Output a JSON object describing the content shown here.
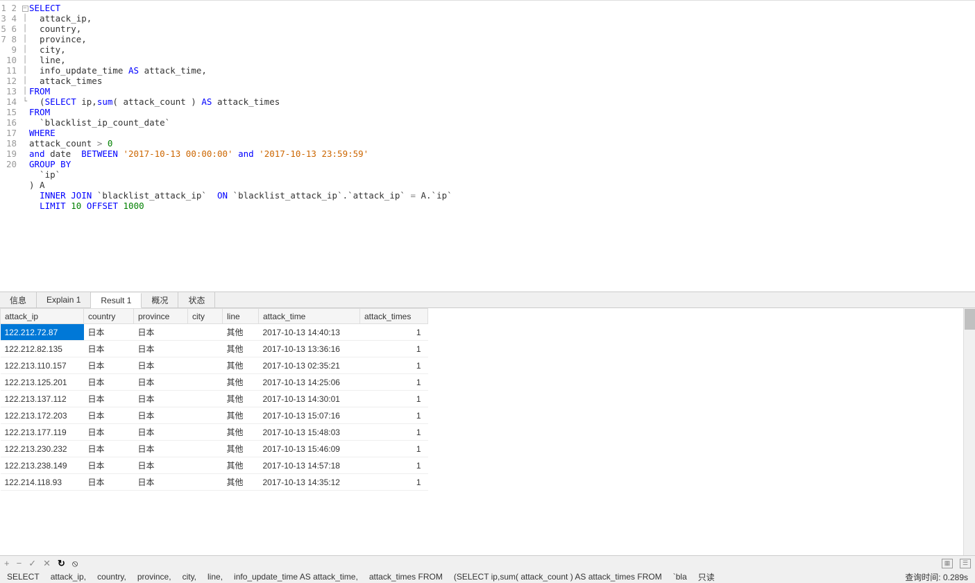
{
  "editor": {
    "lines": [
      {
        "n": 1,
        "html": "<span class='kw'>SELECT</span>"
      },
      {
        "n": 2,
        "html": "  attack_ip,"
      },
      {
        "n": 3,
        "html": "  country,"
      },
      {
        "n": 4,
        "html": "  province,"
      },
      {
        "n": 5,
        "html": "  city,"
      },
      {
        "n": 6,
        "html": "  line,"
      },
      {
        "n": 7,
        "html": "  info_update_time <span class='kw'>AS</span> attack_time,"
      },
      {
        "n": 8,
        "html": "  attack_times"
      },
      {
        "n": 9,
        "html": "<span class='kw'>FROM</span>"
      },
      {
        "n": 10,
        "html": "  (<span class='kw'>SELECT</span> ip,<span class='kw'>sum</span>( attack_count ) <span class='kw'>AS</span> attack_times",
        "fold": true
      },
      {
        "n": 11,
        "html": "<span class='kw'>FROM</span>"
      },
      {
        "n": 12,
        "html": "  `blacklist_ip_count_date`"
      },
      {
        "n": 13,
        "html": "<span class='kw'>WHERE</span>"
      },
      {
        "n": 14,
        "html": "attack_count <span class='op'>&gt;</span> <span class='num'>0</span>"
      },
      {
        "n": 15,
        "html": "<span class='kw'>and</span> date  <span class='kw'>BETWEEN</span> <span class='str'>'2017-10-13 00:00:00'</span> <span class='kw'>and</span> <span class='str'>'2017-10-13 23:59:59'</span>"
      },
      {
        "n": 16,
        "html": "<span class='kw'>GROUP</span> <span class='kw'>BY</span>"
      },
      {
        "n": 17,
        "html": "  `ip`"
      },
      {
        "n": 18,
        "html": ") A"
      },
      {
        "n": 19,
        "html": "  <span class='kw'>INNER</span> <span class='kw'>JOIN</span> `blacklist_attack_ip`  <span class='kw'>ON</span> `blacklist_attack_ip`.`attack_ip` <span class='op'>=</span> A.`ip`"
      },
      {
        "n": 20,
        "html": "  <span class='kw'>LIMIT</span> <span class='num'>10</span> <span class='kw'>OFFSET</span> <span class='num'>1000</span>"
      }
    ]
  },
  "tabs": {
    "items": [
      {
        "label": "信息"
      },
      {
        "label": "Explain 1"
      },
      {
        "label": "Result 1",
        "active": true
      },
      {
        "label": "概况"
      },
      {
        "label": "状态"
      }
    ]
  },
  "grid": {
    "headers": [
      "attack_ip",
      "country",
      "province",
      "city",
      "line",
      "attack_time",
      "attack_times"
    ],
    "rows": [
      {
        "attack_ip": "122.212.72.87",
        "country": "日本",
        "province": "日本",
        "city": "",
        "line": "其他",
        "attack_time": "2017-10-13 14:40:13",
        "attack_times": "1",
        "selected": true
      },
      {
        "attack_ip": "122.212.82.135",
        "country": "日本",
        "province": "日本",
        "city": "",
        "line": "其他",
        "attack_time": "2017-10-13 13:36:16",
        "attack_times": "1"
      },
      {
        "attack_ip": "122.213.110.157",
        "country": "日本",
        "province": "日本",
        "city": "",
        "line": "其他",
        "attack_time": "2017-10-13 02:35:21",
        "attack_times": "1"
      },
      {
        "attack_ip": "122.213.125.201",
        "country": "日本",
        "province": "日本",
        "city": "",
        "line": "其他",
        "attack_time": "2017-10-13 14:25:06",
        "attack_times": "1"
      },
      {
        "attack_ip": "122.213.137.112",
        "country": "日本",
        "province": "日本",
        "city": "",
        "line": "其他",
        "attack_time": "2017-10-13 14:30:01",
        "attack_times": "1"
      },
      {
        "attack_ip": "122.213.172.203",
        "country": "日本",
        "province": "日本",
        "city": "",
        "line": "其他",
        "attack_time": "2017-10-13 15:07:16",
        "attack_times": "1"
      },
      {
        "attack_ip": "122.213.177.119",
        "country": "日本",
        "province": "日本",
        "city": "",
        "line": "其他",
        "attack_time": "2017-10-13 15:48:03",
        "attack_times": "1"
      },
      {
        "attack_ip": "122.213.230.232",
        "country": "日本",
        "province": "日本",
        "city": "",
        "line": "其他",
        "attack_time": "2017-10-13 15:46:09",
        "attack_times": "1"
      },
      {
        "attack_ip": "122.213.238.149",
        "country": "日本",
        "province": "日本",
        "city": "",
        "line": "其他",
        "attack_time": "2017-10-13 14:57:18",
        "attack_times": "1"
      },
      {
        "attack_ip": "122.214.118.93",
        "country": "日本",
        "province": "日本",
        "city": "",
        "line": "其他",
        "attack_time": "2017-10-13 14:35:12",
        "attack_times": "1"
      }
    ]
  },
  "toolbar": {
    "add": "+",
    "remove": "−",
    "apply": "✓",
    "cancel": "✕",
    "refresh": "↻",
    "stop": "⦸"
  },
  "status": {
    "sql_parts": [
      "SELECT",
      "attack_ip,",
      "country,",
      "province,",
      "city,",
      "line,",
      "info_update_time AS attack_time,",
      "attack_times FROM",
      "(SELECT ip,sum( attack_count ) AS attack_times  FROM",
      "`bla"
    ],
    "readonly": "只读",
    "query_time_label": "查询时间:",
    "query_time_value": "0.289s"
  }
}
